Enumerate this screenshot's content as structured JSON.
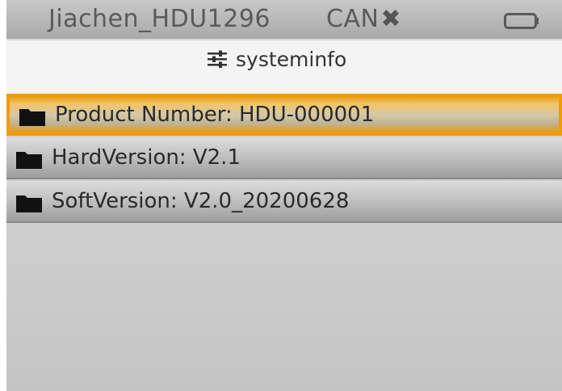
{
  "status_bar": {
    "device_name": "Jiachen_HDU1296",
    "can_label": "CAN",
    "can_state_icon": "x-icon",
    "battery_icon": "battery-icon"
  },
  "title_bar": {
    "icon": "sliders-icon",
    "title": "systeminfo"
  },
  "list": {
    "items": [
      {
        "label": "Product Number: HDU-000001",
        "icon": "folder-icon",
        "selected": true
      },
      {
        "label": "HardVersion: V2.1",
        "icon": "folder-icon",
        "selected": false
      },
      {
        "label": "SoftVersion: V2.0_20200628",
        "icon": "folder-icon",
        "selected": false
      }
    ]
  },
  "colors": {
    "selection": "#f29b05",
    "status_text": "#5a5a5a"
  }
}
